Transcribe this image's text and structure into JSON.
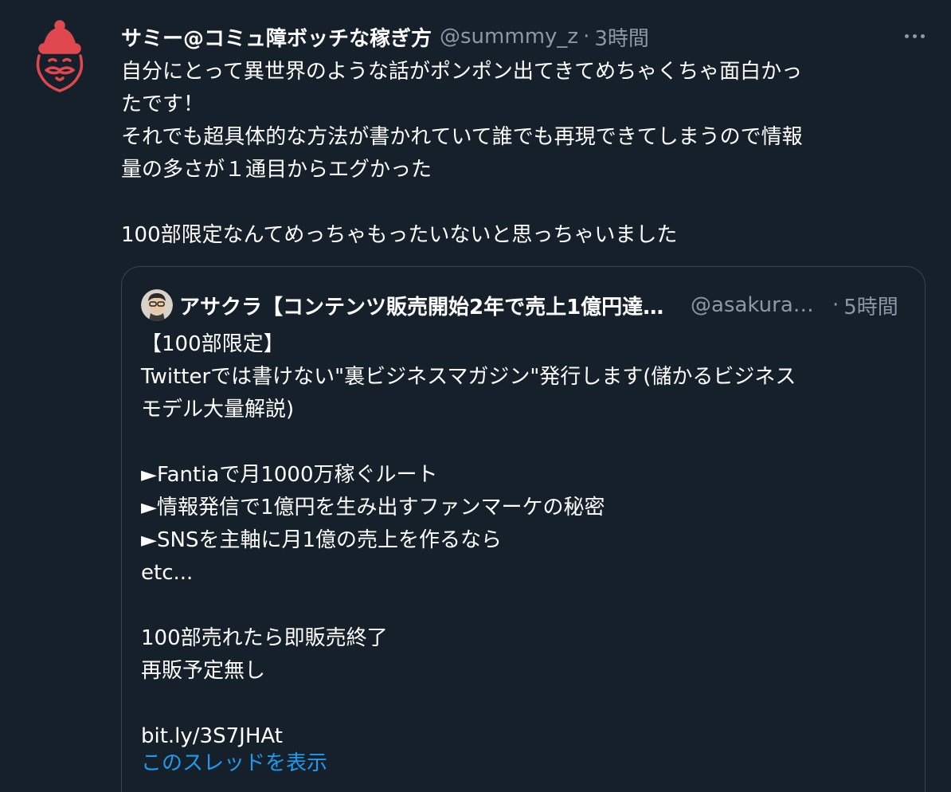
{
  "tweet": {
    "author_name": "サミー@コミュ障ボッチな稼ぎ方",
    "handle": "@summmy_z",
    "separator": "·",
    "time": "3時間",
    "text": "自分にとって異世界のような話がポンポン出てきてめちゃくちゃ面白かっ\nたです！\nそれでも超具体的な方法が書かれていて誰でも再現できてしまうので情報\n量の多さが１通目からエグかった\n\n100部限定なんてめっちゃもったいないと思っちゃいました"
  },
  "quoted": {
    "author_name": "アサクラ【コンテンツ販売開始2年で売上1億円達成】",
    "handle": "@asakura_contents",
    "separator": "·",
    "time": "5時間",
    "text": "【100部限定】\nTwitterでは書けない\"裏ビジネスマガジン\"発行します(儲かるビジネス\nモデル大量解説)\n\n►Fantiaで月1000万稼ぐルート\n►情報発信で1億円を生み出すファンマーケの秘密\n►SNSを主軸に月1億の売上を作るなら\netc...\n\n100部売れたら即販売終了\n再販予定無し\n\nbit.ly/3S7JHAt",
    "thread_link": "このスレッドを表示"
  },
  "icons": {
    "avatar": "santa-avatar-icon",
    "more": "more-horizontal-icon"
  },
  "colors": {
    "background": "#15202b",
    "text": "#ffffff",
    "secondary": "#8b98a5",
    "link": "#1d9bf0",
    "border": "#38444d",
    "avatar_red": "#e0484f"
  }
}
